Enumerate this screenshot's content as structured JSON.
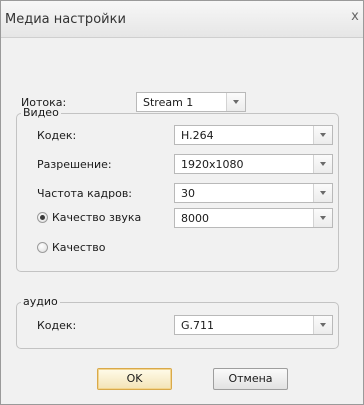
{
  "window": {
    "title": "Медиа настройки",
    "close_glyph": "x"
  },
  "stream": {
    "label": "Иотока:",
    "value": "Stream 1"
  },
  "video": {
    "legend": "Видео",
    "codec_label": "Кодек:",
    "codec_value": "H.264",
    "resolution_label": "Разрешение:",
    "resolution_value": "1920x1080",
    "framerate_label": "Частота кадров:",
    "framerate_value": "30",
    "sound_quality_label": "Качество звука",
    "sound_quality_value": "8000",
    "sound_quality_selected": true,
    "quality_label": "Качество",
    "quality_selected": false
  },
  "audio": {
    "legend": "аудио",
    "codec_label": "Кодек:",
    "codec_value": "G.711"
  },
  "buttons": {
    "ok": "OK",
    "cancel": "Отмена"
  },
  "icons": {
    "dropdown": "chevron-down-icon",
    "close": "close-icon"
  }
}
